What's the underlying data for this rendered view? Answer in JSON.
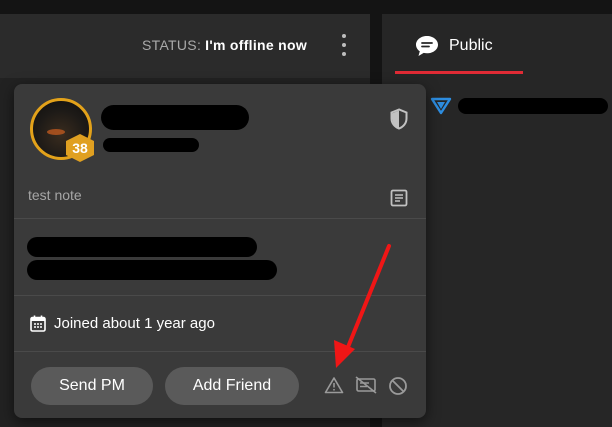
{
  "header": {
    "status_label": "STATUS:",
    "status_value": "I'm offline now"
  },
  "chat": {
    "tab_label": "Public"
  },
  "profile_popup": {
    "level": "38",
    "note": "test note",
    "joined_text": "Joined about 1 year ago",
    "buttons": {
      "send_pm": "Send PM",
      "add_friend": "Add Friend"
    }
  },
  "colors": {
    "accent_red": "#e02b35",
    "badge_gold": "#e0a021",
    "button_bg": "#5a5a5a",
    "popup_bg": "#3a3a3a"
  },
  "icons": [
    "kebab-menu-icon",
    "chat-bubble-icon",
    "triangle-icon",
    "shield-icon",
    "note-icon",
    "calendar-icon",
    "report-icon",
    "mute-chat-icon",
    "block-icon"
  ]
}
